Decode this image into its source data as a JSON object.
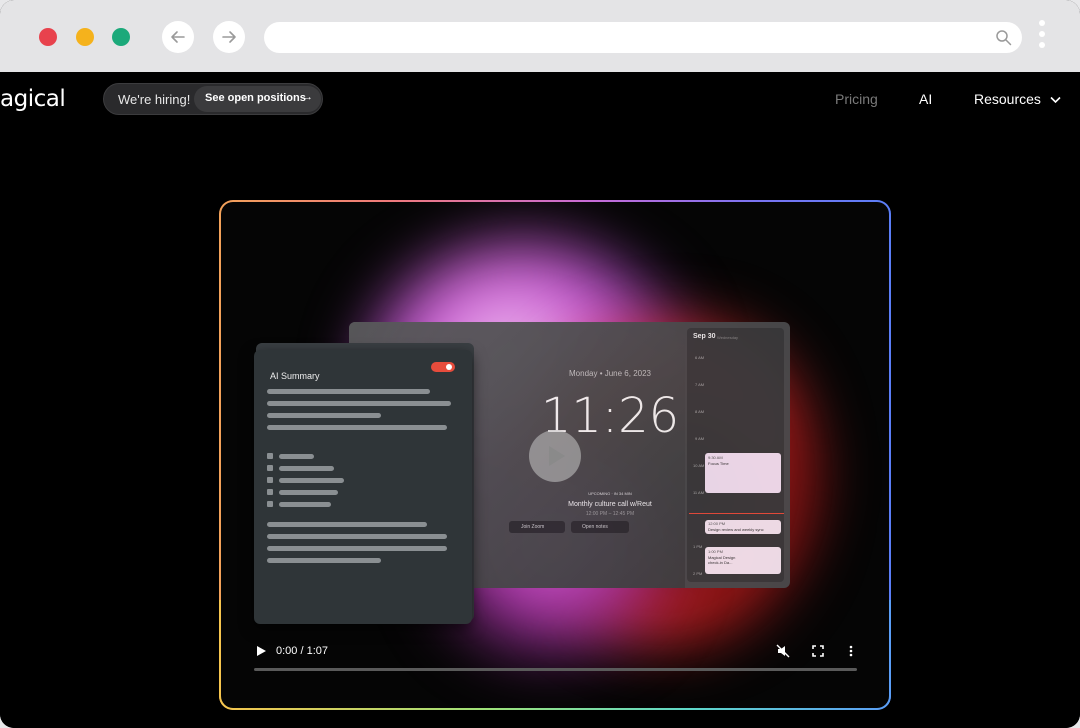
{
  "browser": {
    "traffic_lights": [
      "#e8424d",
      "#f5b21c",
      "#1ba97a"
    ],
    "back_icon": "arrow-left-icon",
    "forward_icon": "arrow-right-icon",
    "search_icon": "search-icon"
  },
  "nav": {
    "logo": "agical",
    "hiring_text": "We're hiring!",
    "positions_label": "See open positions",
    "items": [
      {
        "label": "Pricing"
      },
      {
        "label": "AI"
      },
      {
        "label": "Resources"
      }
    ]
  },
  "video": {
    "ai_summary_title": "AI Summary",
    "date_line": "Monday • June 6, 2023",
    "clock": "11:26",
    "upcoming_badge": "UPCOMING · IN 34 MIN",
    "meeting_title": "Monthly culture call w/Reut",
    "meeting_time": "12:00 PM – 12:45 PM",
    "join_label": "Join Zoom",
    "notes_label": "Open notes",
    "calendar_date": "Sep 30",
    "calendar_day": "Wednesday",
    "hours": [
      "6 AM",
      "7 AM",
      "8 AM",
      "9 AM",
      "10 AM",
      "11 AM",
      "",
      "1 PM",
      "2 PM"
    ],
    "events": [
      {
        "time": "9:30 AM",
        "title": "Focus Time"
      },
      {
        "time": "12:00 PM",
        "title": "Design review and weekly sync"
      },
      {
        "time": "1:00 PM",
        "title": "Magical Design check-in Da..."
      }
    ],
    "current_time": "11:26 AM",
    "player_time": "0:00 / 1:07",
    "accent": "#e74c3c"
  }
}
